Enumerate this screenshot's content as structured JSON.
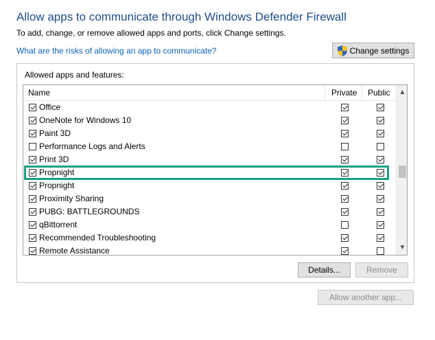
{
  "header": {
    "title": "Allow apps to communicate through Windows Defender Firewall",
    "subtitle": "To add, change, or remove allowed apps and ports, click Change settings.",
    "risk_link": "What are the risks of allowing an app to communicate?",
    "change_settings_label": "Change settings"
  },
  "group": {
    "label": "Allowed apps and features:",
    "columns": {
      "name": "Name",
      "private": "Private",
      "public": "Public"
    },
    "rows": [
      {
        "name": "Office",
        "enabled": true,
        "private": true,
        "public": true
      },
      {
        "name": "OneNote for Windows 10",
        "enabled": true,
        "private": true,
        "public": true
      },
      {
        "name": "Paint 3D",
        "enabled": true,
        "private": true,
        "public": true
      },
      {
        "name": "Performance Logs and Alerts",
        "enabled": false,
        "private": false,
        "public": false
      },
      {
        "name": "Print 3D",
        "enabled": true,
        "private": true,
        "public": true
      },
      {
        "name": "Propnight",
        "enabled": true,
        "private": true,
        "public": true
      },
      {
        "name": "Propnight",
        "enabled": true,
        "private": true,
        "public": true
      },
      {
        "name": "Proximity Sharing",
        "enabled": true,
        "private": true,
        "public": true
      },
      {
        "name": "PUBG: BATTLEGROUNDS",
        "enabled": true,
        "private": true,
        "public": true
      },
      {
        "name": "qBittorrent",
        "enabled": true,
        "private": false,
        "public": true
      },
      {
        "name": "Recommended Troubleshooting",
        "enabled": true,
        "private": true,
        "public": true
      },
      {
        "name": "Remote Assistance",
        "enabled": true,
        "private": true,
        "public": false
      }
    ],
    "details_label": "Details...",
    "remove_label": "Remove"
  },
  "footer": {
    "allow_another_label": "Allow another app..."
  },
  "icons": {
    "shield": "uac-shield-icon",
    "scroll_up": "chevron-up-icon",
    "scroll_down": "chevron-down-icon"
  },
  "colors": {
    "title": "#1e4e8c",
    "link": "#0b63b5",
    "highlight": "#17a085"
  }
}
